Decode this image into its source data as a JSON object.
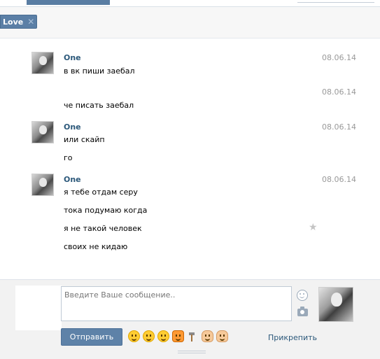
{
  "filter_tag": {
    "label": "Love"
  },
  "messages": [
    {
      "author": "One",
      "date": "08.06.14",
      "lines": [
        "в вк пиши заебал"
      ]
    },
    {
      "author": "",
      "date": "08.06.14",
      "lines": [
        "че писать заебал"
      ]
    },
    {
      "author": "One",
      "date": "08.06.14",
      "lines": [
        "или скайп",
        "го"
      ]
    },
    {
      "author": "One",
      "date": "08.06.14",
      "lines": [
        "я тебе отдам серу",
        "тока подумаю когда",
        "я не такой человек",
        "своих не кидаю"
      ]
    }
  ],
  "composer": {
    "placeholder": "Введите Ваше сообщение..",
    "send_label": "Отправить",
    "attach_label": "Прикрепить",
    "emoji_icons": [
      "smile-emoji-icon",
      "laugh-emoji-icon",
      "tired-emoji-icon",
      "tiger-emoji-icon",
      "hammer-emoji-icon",
      "pointing-finger-emoji-icon",
      "ok-hand-emoji-icon"
    ]
  },
  "colors": {
    "accent": "#5e82a8",
    "link": "#2b587a",
    "date": "#999999",
    "composer_bg": "#f2f2f2"
  }
}
